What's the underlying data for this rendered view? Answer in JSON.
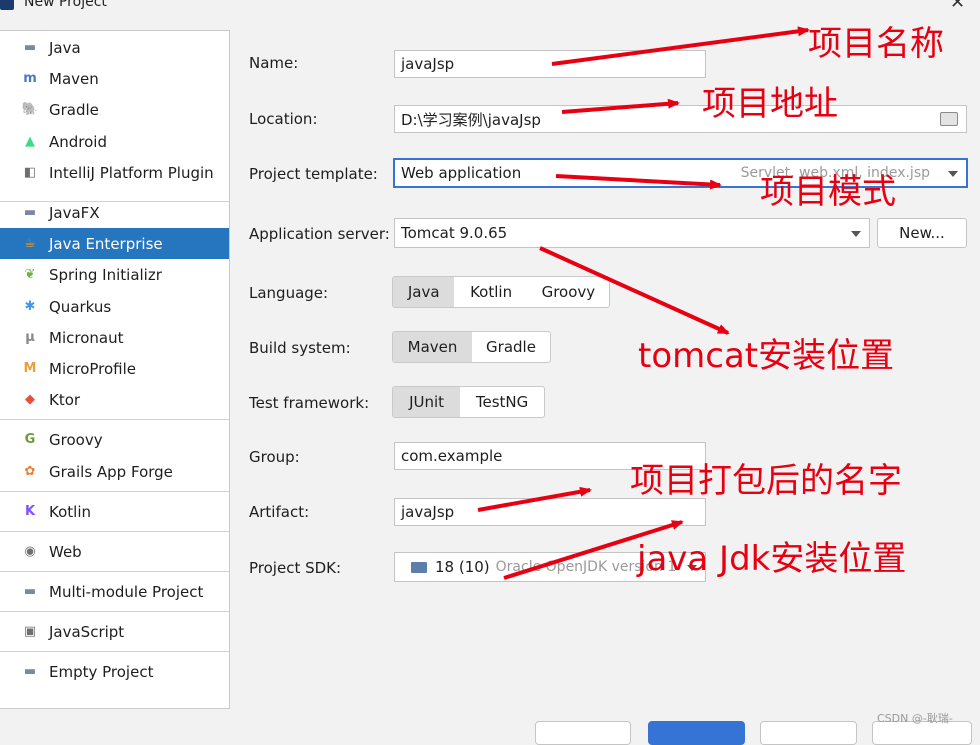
{
  "window": {
    "title": "New Project"
  },
  "sidebar": {
    "items": [
      {
        "label": "Java",
        "icon": "folder-icon"
      },
      {
        "label": "Maven",
        "icon": "maven-icon"
      },
      {
        "label": "Gradle",
        "icon": "gradle-icon"
      },
      {
        "label": "Android",
        "icon": "android-icon"
      },
      {
        "label": "IntelliJ Platform Plugin",
        "icon": "plugin-icon"
      },
      {
        "label": "JavaFX",
        "icon": "folder-icon"
      },
      {
        "label": "Java Enterprise",
        "icon": "java-enterprise-icon"
      },
      {
        "label": "Spring Initializr",
        "icon": "spring-icon"
      },
      {
        "label": "Quarkus",
        "icon": "quarkus-icon"
      },
      {
        "label": "Micronaut",
        "icon": "micronaut-icon"
      },
      {
        "label": "MicroProfile",
        "icon": "microprofile-icon"
      },
      {
        "label": "Ktor",
        "icon": "ktor-icon"
      },
      {
        "label": "Groovy",
        "icon": "groovy-icon"
      },
      {
        "label": "Grails App Forge",
        "icon": "grails-icon"
      },
      {
        "label": "Kotlin",
        "icon": "kotlin-icon"
      },
      {
        "label": "Web",
        "icon": "web-icon"
      },
      {
        "label": "Multi-module Project",
        "icon": "folder-icon"
      },
      {
        "label": "JavaScript",
        "icon": "javascript-icon"
      },
      {
        "label": "Empty Project",
        "icon": "folder-icon"
      }
    ],
    "selected": "Java Enterprise"
  },
  "form": {
    "name_label": "Name:",
    "name_value": "javaJsp",
    "location_label": "Location:",
    "location_value": "D:\\学习案例\\javaJsp",
    "template_label": "Project template:",
    "template_value": "Web application",
    "template_hint": "Servlet, web.xml, index.jsp",
    "server_label": "Application server:",
    "server_value": "Tomcat 9.0.65",
    "server_new": "New...",
    "language_label": "Language:",
    "language_options": [
      "Java",
      "Kotlin",
      "Groovy"
    ],
    "language_selected": "Java",
    "build_label": "Build system:",
    "build_options": [
      "Maven",
      "Gradle"
    ],
    "build_selected": "Maven",
    "test_label": "Test framework:",
    "test_options": [
      "JUnit",
      "TestNG"
    ],
    "test_selected": "JUnit",
    "group_label": "Group:",
    "group_value": "com.example",
    "artifact_label": "Artifact:",
    "artifact_value": "javaJsp",
    "sdk_label": "Project SDK:",
    "sdk_value": "18 (10)",
    "sdk_detail": "Oracle OpenJDK version 1"
  },
  "annotations": {
    "a1": "项目名称",
    "a2": "项目地址",
    "a3": "项目模式",
    "a4": "tomcat安装位置",
    "a5": "项目打包后的名字",
    "a6": "java Jdk安装位置"
  },
  "watermark": "CSDN @-耿瑞-",
  "colors": {
    "selection": "#2675bf",
    "annotation": "#e60012",
    "focus": "#3574d4"
  }
}
